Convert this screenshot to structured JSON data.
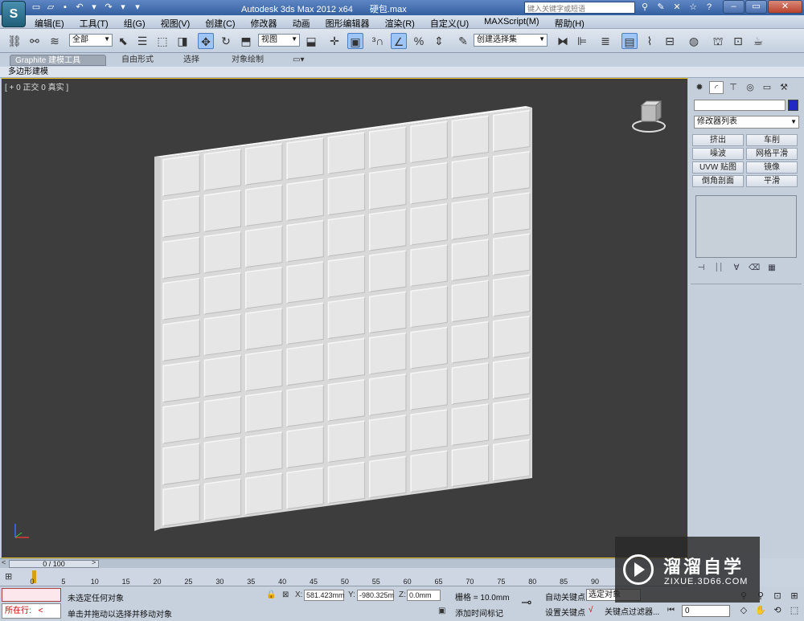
{
  "window": {
    "title_app": "Autodesk 3ds Max  2012 x64",
    "title_file": "硬包.max",
    "search_placeholder": "键入关键字或短语"
  },
  "menu": [
    "编辑(E)",
    "工具(T)",
    "组(G)",
    "视图(V)",
    "创建(C)",
    "修改器",
    "动画",
    "图形编辑器",
    "渲染(R)",
    "自定义(U)",
    "MAXScript(M)",
    "帮助(H)"
  ],
  "toolbar": {
    "selection_filter": "全部",
    "reference_coord": "视图",
    "named_selection": "创建选择集"
  },
  "ribbon": {
    "tabs": [
      "Graphite 建模工具",
      "自由形式",
      "选择",
      "对象绘制"
    ],
    "sub_label": "多边形建模"
  },
  "viewport": {
    "label": "[ + 0 正交 0 真实 ]",
    "object_color": "#e6e6e6",
    "background_color": "#3d3d3d",
    "border_color": "#f2c12e",
    "tile_rows": 9,
    "tile_cols": 9
  },
  "command_panel": {
    "object_color": "#2327c4",
    "modifier_list": "修改器列表",
    "buttons": [
      "挤出",
      "车削",
      "噪波",
      "网格平滑",
      "UVW 贴图",
      "镜像",
      "倒角剖面",
      "平滑"
    ]
  },
  "timeline": {
    "frame_display": "0 / 100",
    "ticks": [
      0,
      5,
      10,
      15,
      20,
      25,
      30,
      35,
      40,
      45,
      50,
      55,
      60,
      65,
      70,
      75,
      80,
      85,
      90
    ]
  },
  "status": {
    "maxscript_label": "所在行:",
    "selection_status": "未选定任何对象",
    "prompt": "单击并拖动以选择并移动对象",
    "x_label": "X:",
    "x_value": "581.423mm",
    "y_label": "Y:",
    "y_value": "-980.325m",
    "z_label": "Z:",
    "z_value": "0.0mm",
    "grid": "栅格 = 10.0mm",
    "add_time_tag": "添加时间标记",
    "auto_key": "自动关键点",
    "set_key": "设置关键点",
    "selected_object": "选定对象",
    "key_filters": "关键点过滤器...",
    "frame": "0"
  },
  "watermark": {
    "title": "溜溜自学",
    "url": "ZIXUE.3D66.COM"
  }
}
